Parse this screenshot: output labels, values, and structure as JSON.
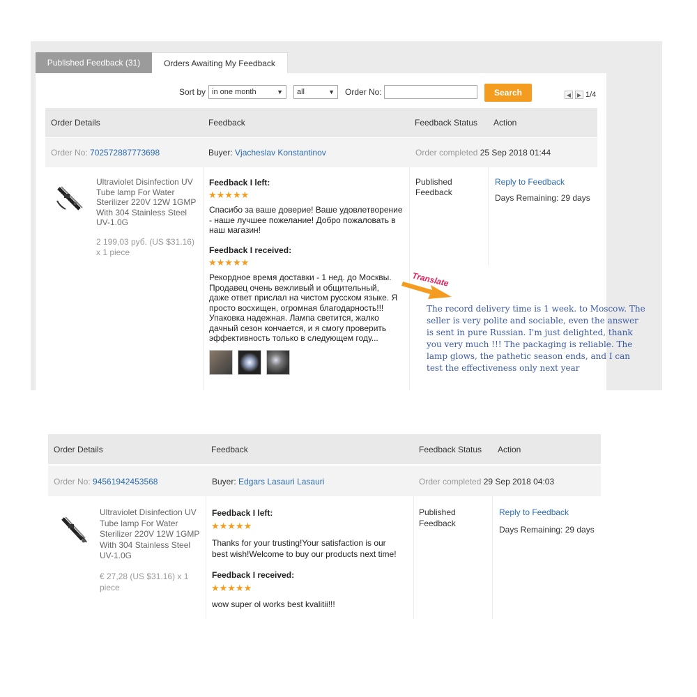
{
  "tabs": {
    "published": "Published Feedback (31)",
    "awaiting": "Orders Awaiting My Feedback"
  },
  "filter": {
    "sort_label": "Sort by",
    "sort_value": "in one month",
    "status_value": "all",
    "order_label": "Order No:",
    "order_value": "",
    "search_label": "Search",
    "page": "1/4"
  },
  "headers": {
    "order_details": "Order Details",
    "feedback": "Feedback",
    "status": "Feedback Status",
    "action": "Action"
  },
  "orders": [
    {
      "order_no_label": "Order No:",
      "order_no": "702572887773698",
      "buyer_label": "Buyer:",
      "buyer": "Vjacheslav Konstantinov",
      "completed_label": "Order completed",
      "completed_date": "25 Sep 2018 01:44",
      "product_lines": [
        "Ultraviolet Disinfection UV",
        "Tube lamp For Water",
        "Sterilizer 220V 12W 1GMP",
        "With 304 Stainless Steel",
        "UV-1.0G"
      ],
      "price_lines": [
        "2 199,03 руб. (US $31.16)",
        "x 1 piece"
      ],
      "left_label": "Feedback I left:",
      "left_stars": "★★★★★",
      "left_lines": [
        "Спасибо за ваше доверие! Ваше удовлетворение",
        "- наше лучшее пожелание! Добро пожаловать в",
        "наш магазин!"
      ],
      "received_label": "Feedback I received:",
      "received_stars": "★★★★★",
      "received_lines": [
        "Рекордное время доставки - 1 нед. до Москвы.",
        "Продавец очень вежливый и общительный,",
        "даже ответ прислал на чистом русском языке. Я",
        "просто восхищен, огромная благодарность!!!",
        "Упаковка надежная. Лампа светится, жалко",
        "дачный сезон кончается, и я смогу проверить",
        "эффективность только в следующем году..."
      ],
      "status_lines": [
        "Published",
        "Feedback"
      ],
      "reply": "Reply to Feedback",
      "days": "Days Remaining: 29 days"
    },
    {
      "order_no_label": "Order No:",
      "order_no": "94561942453568",
      "buyer_label": "Buyer:",
      "buyer": "Edgars Lasauri Lasauri",
      "completed_label": "Order completed",
      "completed_date": "29 Sep 2018 04:03",
      "product_lines": [
        "Ultraviolet Disinfection UV",
        "Tube lamp For Water",
        "Sterilizer 220V 12W 1GMP",
        "With 304 Stainless Steel",
        "UV-1.0G"
      ],
      "price_lines": [
        "€ 27,28 (US $31.16) x 1",
        "piece"
      ],
      "left_label": "Feedback I left:",
      "left_stars": "★★★★★",
      "left_lines": [
        "Thanks for your trusting!Your satisfaction is our",
        "best wish!Welcome to buy our products next time!"
      ],
      "received_label": "Feedback I received:",
      "received_stars": "★★★★★",
      "received_lines": [
        "wow super ol works best kvalitii!!!"
      ],
      "status_lines": [
        "Published",
        "Feedback"
      ],
      "reply": "Reply to Feedback",
      "days": "Days Remaining: 29 days"
    }
  ],
  "annotation": {
    "label": "Translate",
    "color": "#e0245e",
    "arrow_color": "#f39c1f",
    "lines": [
      "The record delivery time is 1 week. to Moscow. The",
      "seller is very polite and sociable, even the answer",
      "is sent in pure Russian. I'm just delighted, thank",
      "you very much !!! The packaging is reliable. The",
      "lamp glows, the pathetic season ends, and I can",
      "test the effectiveness only next year"
    ]
  },
  "icons": {
    "product_image": "uv-lamp-image",
    "photos": [
      "review-photo-1",
      "review-photo-2",
      "review-photo-3"
    ]
  }
}
